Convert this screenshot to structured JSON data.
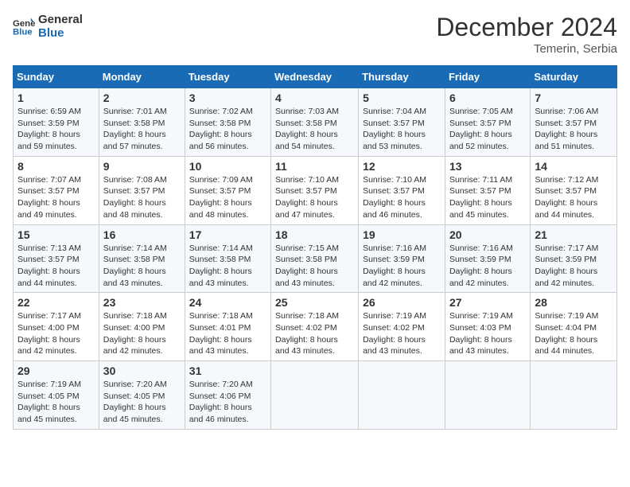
{
  "header": {
    "logo_general": "General",
    "logo_blue": "Blue",
    "month_year": "December 2024",
    "location": "Temerin, Serbia"
  },
  "weekdays": [
    "Sunday",
    "Monday",
    "Tuesday",
    "Wednesday",
    "Thursday",
    "Friday",
    "Saturday"
  ],
  "weeks": [
    [
      {
        "day": 1,
        "sunrise": "6:59 AM",
        "sunset": "3:59 PM",
        "daylight": "8 hours and 59 minutes."
      },
      {
        "day": 2,
        "sunrise": "7:01 AM",
        "sunset": "3:58 PM",
        "daylight": "8 hours and 57 minutes."
      },
      {
        "day": 3,
        "sunrise": "7:02 AM",
        "sunset": "3:58 PM",
        "daylight": "8 hours and 56 minutes."
      },
      {
        "day": 4,
        "sunrise": "7:03 AM",
        "sunset": "3:58 PM",
        "daylight": "8 hours and 54 minutes."
      },
      {
        "day": 5,
        "sunrise": "7:04 AM",
        "sunset": "3:57 PM",
        "daylight": "8 hours and 53 minutes."
      },
      {
        "day": 6,
        "sunrise": "7:05 AM",
        "sunset": "3:57 PM",
        "daylight": "8 hours and 52 minutes."
      },
      {
        "day": 7,
        "sunrise": "7:06 AM",
        "sunset": "3:57 PM",
        "daylight": "8 hours and 51 minutes."
      }
    ],
    [
      {
        "day": 8,
        "sunrise": "7:07 AM",
        "sunset": "3:57 PM",
        "daylight": "8 hours and 49 minutes."
      },
      {
        "day": 9,
        "sunrise": "7:08 AM",
        "sunset": "3:57 PM",
        "daylight": "8 hours and 48 minutes."
      },
      {
        "day": 10,
        "sunrise": "7:09 AM",
        "sunset": "3:57 PM",
        "daylight": "8 hours and 48 minutes."
      },
      {
        "day": 11,
        "sunrise": "7:10 AM",
        "sunset": "3:57 PM",
        "daylight": "8 hours and 47 minutes."
      },
      {
        "day": 12,
        "sunrise": "7:10 AM",
        "sunset": "3:57 PM",
        "daylight": "8 hours and 46 minutes."
      },
      {
        "day": 13,
        "sunrise": "7:11 AM",
        "sunset": "3:57 PM",
        "daylight": "8 hours and 45 minutes."
      },
      {
        "day": 14,
        "sunrise": "7:12 AM",
        "sunset": "3:57 PM",
        "daylight": "8 hours and 44 minutes."
      }
    ],
    [
      {
        "day": 15,
        "sunrise": "7:13 AM",
        "sunset": "3:57 PM",
        "daylight": "8 hours and 44 minutes."
      },
      {
        "day": 16,
        "sunrise": "7:14 AM",
        "sunset": "3:58 PM",
        "daylight": "8 hours and 43 minutes."
      },
      {
        "day": 17,
        "sunrise": "7:14 AM",
        "sunset": "3:58 PM",
        "daylight": "8 hours and 43 minutes."
      },
      {
        "day": 18,
        "sunrise": "7:15 AM",
        "sunset": "3:58 PM",
        "daylight": "8 hours and 43 minutes."
      },
      {
        "day": 19,
        "sunrise": "7:16 AM",
        "sunset": "3:59 PM",
        "daylight": "8 hours and 42 minutes."
      },
      {
        "day": 20,
        "sunrise": "7:16 AM",
        "sunset": "3:59 PM",
        "daylight": "8 hours and 42 minutes."
      },
      {
        "day": 21,
        "sunrise": "7:17 AM",
        "sunset": "3:59 PM",
        "daylight": "8 hours and 42 minutes."
      }
    ],
    [
      {
        "day": 22,
        "sunrise": "7:17 AM",
        "sunset": "4:00 PM",
        "daylight": "8 hours and 42 minutes."
      },
      {
        "day": 23,
        "sunrise": "7:18 AM",
        "sunset": "4:00 PM",
        "daylight": "8 hours and 42 minutes."
      },
      {
        "day": 24,
        "sunrise": "7:18 AM",
        "sunset": "4:01 PM",
        "daylight": "8 hours and 43 minutes."
      },
      {
        "day": 25,
        "sunrise": "7:18 AM",
        "sunset": "4:02 PM",
        "daylight": "8 hours and 43 minutes."
      },
      {
        "day": 26,
        "sunrise": "7:19 AM",
        "sunset": "4:02 PM",
        "daylight": "8 hours and 43 minutes."
      },
      {
        "day": 27,
        "sunrise": "7:19 AM",
        "sunset": "4:03 PM",
        "daylight": "8 hours and 43 minutes."
      },
      {
        "day": 28,
        "sunrise": "7:19 AM",
        "sunset": "4:04 PM",
        "daylight": "8 hours and 44 minutes."
      }
    ],
    [
      {
        "day": 29,
        "sunrise": "7:19 AM",
        "sunset": "4:05 PM",
        "daylight": "8 hours and 45 minutes."
      },
      {
        "day": 30,
        "sunrise": "7:20 AM",
        "sunset": "4:05 PM",
        "daylight": "8 hours and 45 minutes."
      },
      {
        "day": 31,
        "sunrise": "7:20 AM",
        "sunset": "4:06 PM",
        "daylight": "8 hours and 46 minutes."
      },
      null,
      null,
      null,
      null
    ]
  ],
  "labels": {
    "sunrise": "Sunrise:",
    "sunset": "Sunset:",
    "daylight": "Daylight:"
  }
}
